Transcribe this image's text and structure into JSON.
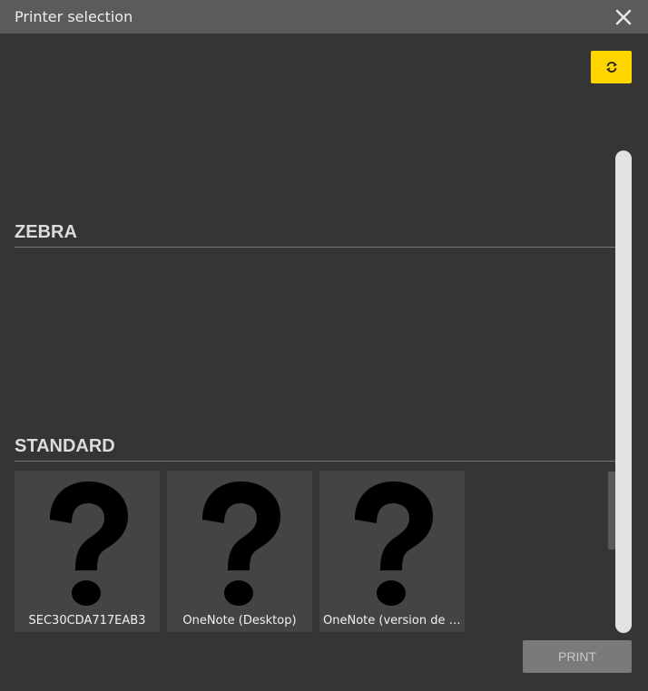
{
  "dialog": {
    "title": "Printer selection",
    "close_icon": "close-icon",
    "refresh_icon": "refresh-icon",
    "accent_color": "#ffd500"
  },
  "sections": [
    {
      "title": "ZEBRA",
      "printers": []
    },
    {
      "title": "STANDARD",
      "printers": [
        {
          "name": "SEC30CDA717EAB3",
          "icon": "question-mark-icon"
        },
        {
          "name": "OneNote (Desktop)",
          "icon": "question-mark-icon"
        },
        {
          "name": "OneNote (version de b...",
          "icon": "question-mark-icon"
        }
      ]
    }
  ],
  "footer": {
    "print_label": "PRINT",
    "print_enabled": false
  }
}
